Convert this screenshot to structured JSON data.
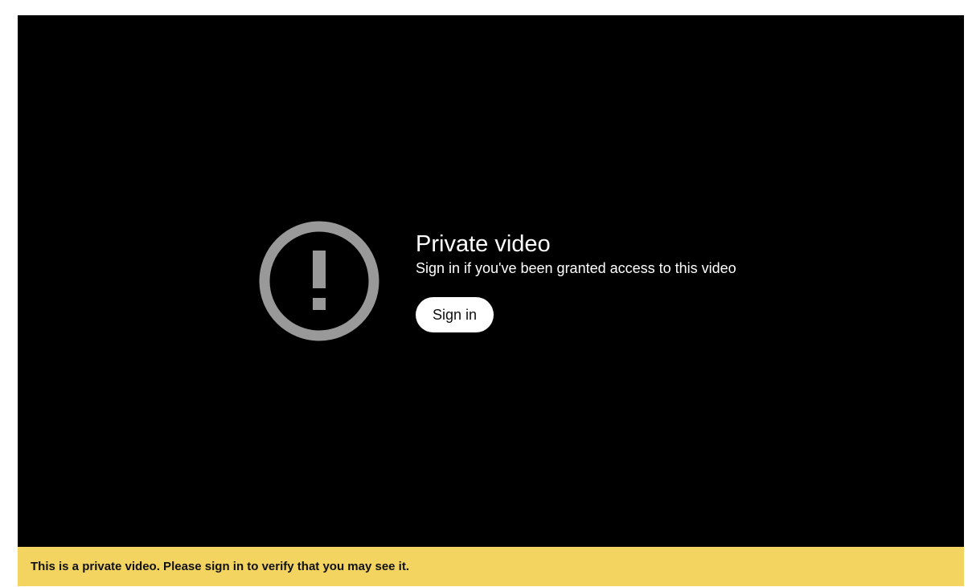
{
  "player": {
    "error_title": "Private video",
    "error_subtitle": "Sign in if you've been granted access to this video",
    "signin_label": "Sign in",
    "icon": "alert-circle-icon",
    "colors": {
      "background": "#000000",
      "icon": "#999999",
      "text": "#ffffff"
    }
  },
  "notice": {
    "text": "This is a private video. Please sign in to verify that you may see it.",
    "background": "#f3d461"
  }
}
